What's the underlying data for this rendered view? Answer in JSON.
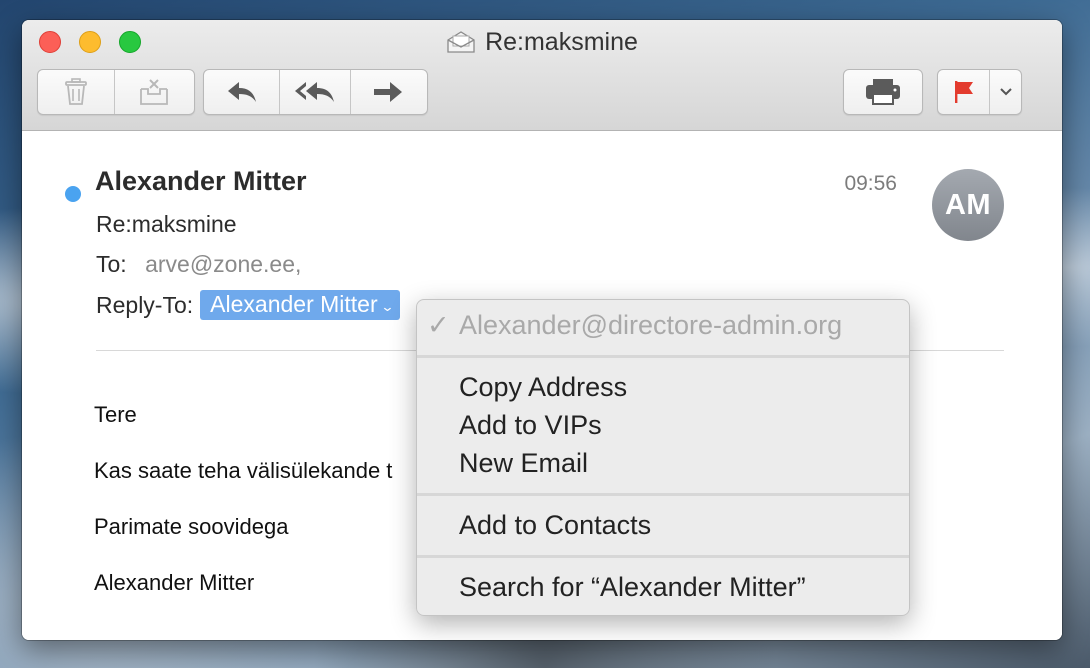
{
  "window": {
    "title": "Re:maksmine"
  },
  "toolbar": {
    "buttons": [
      {
        "name": "delete-button",
        "icon": "trash-icon",
        "enabled": false
      },
      {
        "name": "junk-button",
        "icon": "junk-tray-icon",
        "enabled": false
      },
      {
        "name": "reply-button",
        "icon": "reply-arrow-icon"
      },
      {
        "name": "reply-all-button",
        "icon": "reply-all-arrow-icon"
      },
      {
        "name": "forward-button",
        "icon": "forward-arrow-icon"
      },
      {
        "name": "print-button",
        "icon": "printer-icon"
      },
      {
        "name": "flag-button",
        "icon": "flag-icon",
        "color": "#e33b2e"
      },
      {
        "name": "flag-menu-button",
        "icon": "chevron-down-icon"
      }
    ]
  },
  "message": {
    "sender": "Alexander Mitter",
    "time": "09:56",
    "avatar_initials": "AM",
    "subject": "Re:maksmine",
    "to_label": "To:",
    "to_address": "arve@zone.ee,",
    "reply_to_label": "Reply-To:",
    "reply_to_name": "Alexander Mitter",
    "body": [
      "Tere",
      "Kas saate teha välisülekande t",
      "Parimate soovidega",
      "Alexander Mitter"
    ]
  },
  "context_menu": {
    "selected_address": "Alexander@directore-admin.org",
    "items": [
      "Copy Address",
      "Add to VIPs",
      "New Email",
      "Add to Contacts",
      "Search for “Alexander Mitter”"
    ]
  },
  "colors": {
    "unread_dot": "#4aa3f0",
    "token_bg": "#6fa9ec",
    "flag": "#e33b2e"
  }
}
